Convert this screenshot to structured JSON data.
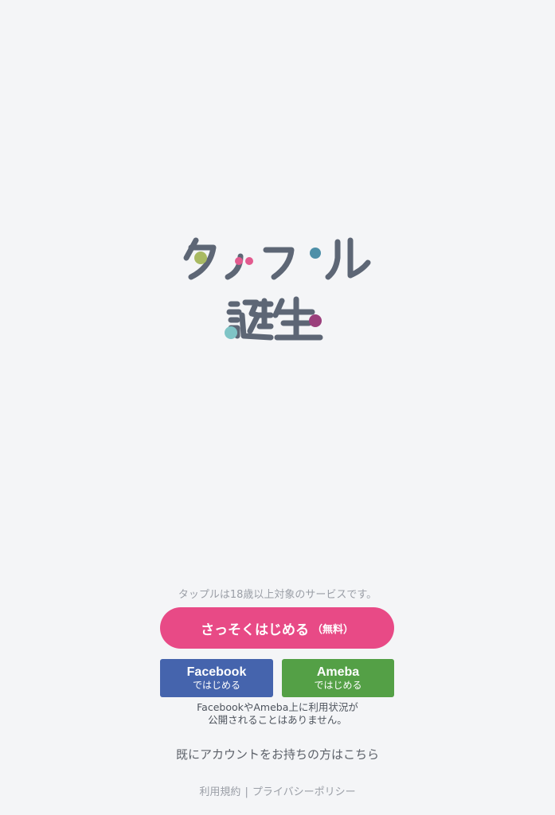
{
  "logo": {
    "line1": "タップル",
    "line2": "誕生",
    "colors": {
      "text": "#5d6675",
      "green": "#a9ba62",
      "pink": "#e25a8e",
      "teal_blue": "#4d8fa8",
      "teal": "#7fc4c6",
      "purple": "#9b3f7c"
    }
  },
  "age_note": "タップルは18歳以上対象のサービスです。",
  "start_button": {
    "label": "さっそくはじめる",
    "suffix": "（無料）",
    "color": "#e84a86"
  },
  "facebook_button": {
    "brand": "Facebook",
    "sub": "ではじめる",
    "color": "#4564ad"
  },
  "ameba_button": {
    "brand": "Ameba",
    "sub": "ではじめる",
    "color": "#54a046"
  },
  "privacy_note": {
    "line1": "FacebookやAmeba上に利用状況が",
    "line2": "公開されることはありません。"
  },
  "login_link": "既にアカウントをお持ちの方はこちら",
  "footer": {
    "terms": "利用規約",
    "separator": "|",
    "privacy": "プライバシーポリシー"
  }
}
